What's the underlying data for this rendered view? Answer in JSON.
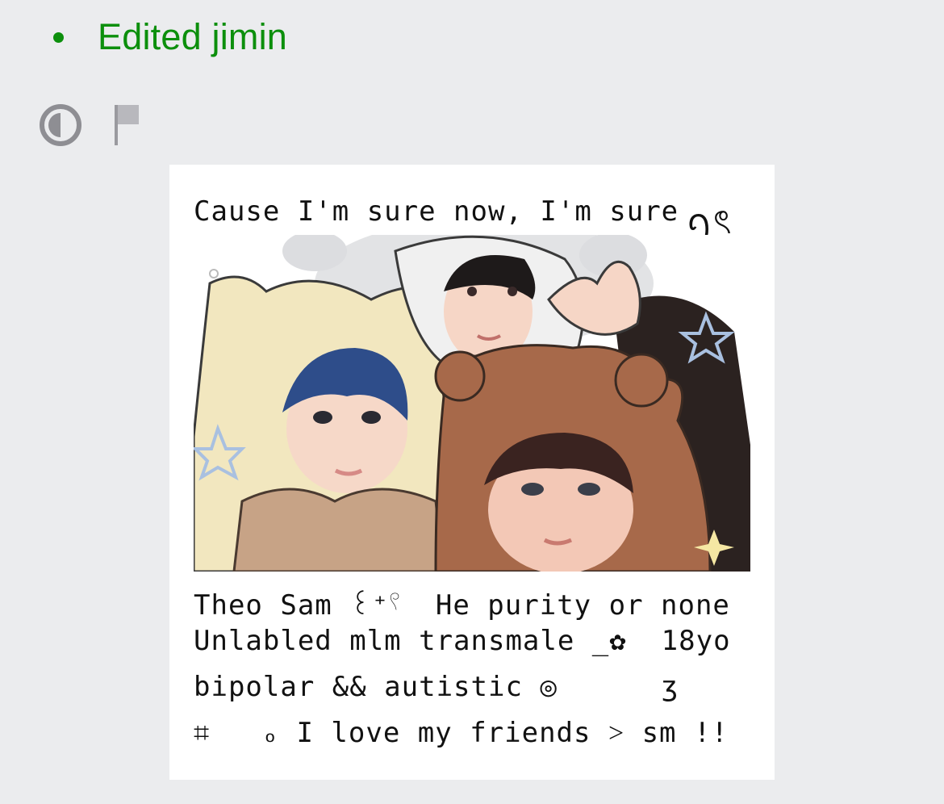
{
  "status": {
    "label": "Edited jimin"
  },
  "toolbar": {
    "contrast_icon": "contrast-icon",
    "flag_icon": "flag-icon"
  },
  "card": {
    "header_text": "Cause I'm sure now, I'm sure",
    "header_glyph": "ꪆৎ",
    "lines": [
      "Theo Sam ꒰⁺𓍢  He purity or none",
      "Unlabled mlm transmale _✿  18yo",
      "bipolar && autistic ◎      ʒ",
      "⌗   ₒ I love my friends ˃ sm !!"
    ]
  },
  "colors": {
    "status_green": "#0c8f0c",
    "page_bg": "#ebecee",
    "card_bg": "#ffffff"
  }
}
